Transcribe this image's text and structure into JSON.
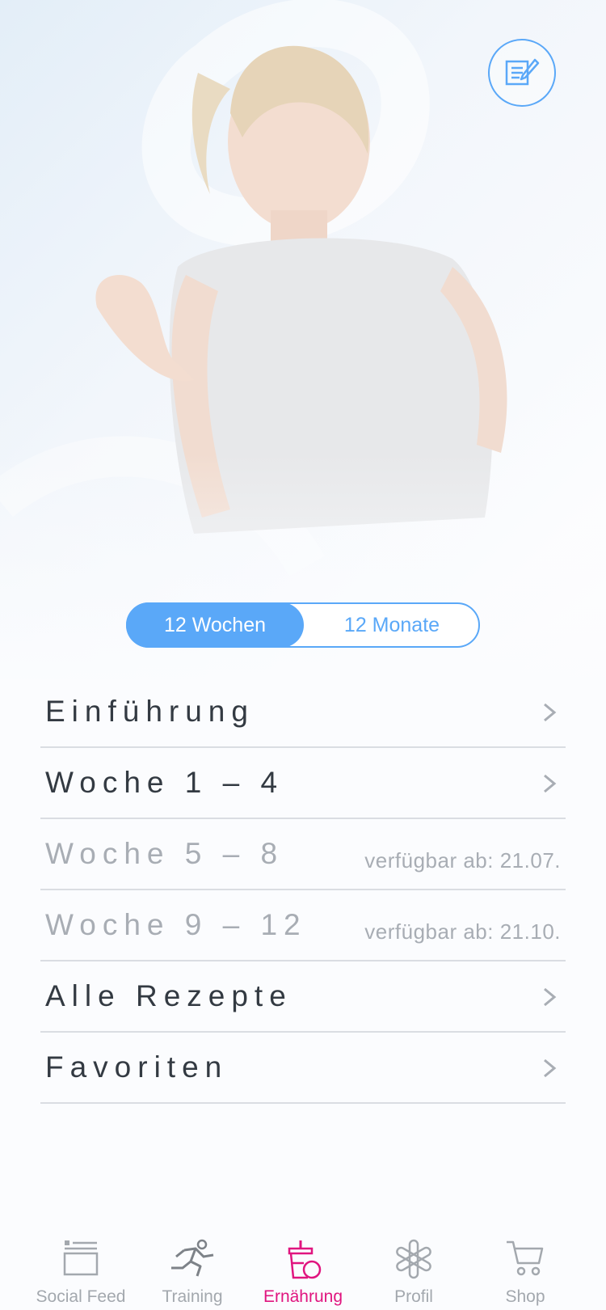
{
  "header": {
    "notes_icon": "notes-edit-icon"
  },
  "segment": {
    "options": [
      "12 Wochen",
      "12 Monate"
    ],
    "selected": "12 Wochen"
  },
  "menu": {
    "items": [
      {
        "label": "Einführung",
        "available_text": "",
        "locked": false
      },
      {
        "label": "Woche 1 – 4",
        "available_text": "",
        "locked": false
      },
      {
        "label": "Woche 5 – 8",
        "available_text": "verfügbar ab: 21.07.",
        "locked": true
      },
      {
        "label": "Woche 9 – 12",
        "available_text": "verfügbar ab: 21.10.",
        "locked": true
      },
      {
        "label": "Alle Rezepte",
        "available_text": "",
        "locked": false
      },
      {
        "label": "Favoriten",
        "available_text": "",
        "locked": false
      }
    ]
  },
  "tabbar": {
    "tabs": [
      {
        "label": "Social Feed",
        "icon": "social-feed-icon"
      },
      {
        "label": "Training",
        "icon": "running-icon"
      },
      {
        "label": "Ernährung",
        "icon": "drink-cup-icon"
      },
      {
        "label": "Profil",
        "icon": "asterisk-profile-icon"
      },
      {
        "label": "Shop",
        "icon": "cart-icon"
      }
    ],
    "active": "Ernährung"
  },
  "colors": {
    "accent": "#5aa8f8",
    "active_tab": "#e0157f",
    "text": "#333a42",
    "muted": "#a8adb4"
  }
}
